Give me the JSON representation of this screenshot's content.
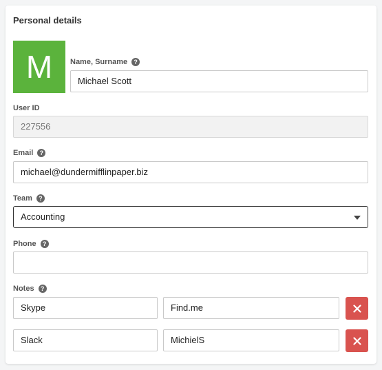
{
  "section_title": "Personal details",
  "avatar": {
    "letter": "M",
    "color": "#5bb33c"
  },
  "fields": {
    "name_label": "Name, Surname",
    "name_value": "Michael Scott",
    "userid_label": "User ID",
    "userid_value": "227556",
    "email_label": "Email",
    "email_value": "michael@dundermifflinpaper.biz",
    "team_label": "Team",
    "team_value": "Accounting",
    "phone_label": "Phone",
    "phone_value": "",
    "notes_label": "Notes"
  },
  "notes": [
    {
      "key": "Skype",
      "value": "Find.me"
    },
    {
      "key": "Slack",
      "value": "MichielS"
    }
  ],
  "help_icon": "question-icon",
  "delete_icon": "close-icon",
  "colors": {
    "delete": "#d9534f",
    "avatar": "#5bb33c"
  }
}
